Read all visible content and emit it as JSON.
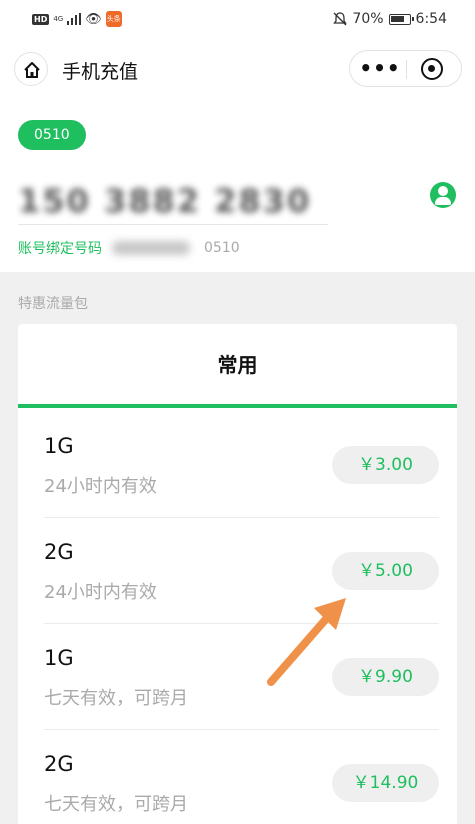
{
  "status_bar": {
    "hd": "HD",
    "network": "4G",
    "app_badge": "头条",
    "battery_percent": "70%",
    "time": "6:54"
  },
  "nav": {
    "title": "手机充值",
    "more_label": "•••"
  },
  "account": {
    "tag": "0510",
    "phone_number": "150 3882 2830",
    "bind_label": "账号绑定号码",
    "bind_suffix": "0510"
  },
  "section_label": "特惠流量包",
  "tab_label": "常用",
  "packages": [
    {
      "size": "1G",
      "desc": "24小时内有效",
      "price": "￥3.00"
    },
    {
      "size": "2G",
      "desc": "24小时内有效",
      "price": "￥5.00"
    },
    {
      "size": "1G",
      "desc": "七天有效，可跨月",
      "price": "￥9.90"
    },
    {
      "size": "2G",
      "desc": "七天有效，可跨月",
      "price": "￥14.90"
    }
  ],
  "colors": {
    "accent": "#1fbf5f",
    "annotation_arrow": "#f0914a"
  },
  "icons": {
    "home": "home-icon",
    "more": "more-dots-icon",
    "close": "close-target-icon",
    "contact": "contact-person-icon"
  }
}
